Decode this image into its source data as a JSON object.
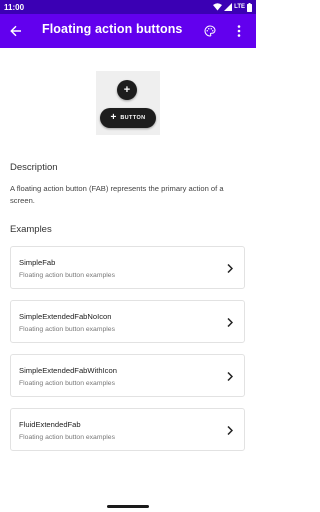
{
  "status_bar": {
    "time": "11:00",
    "network": "LTE",
    "icons": [
      "wifi-icon",
      "signal-icon",
      "battery-icon"
    ]
  },
  "app_bar": {
    "title": "Floating action buttons",
    "back_icon": "arrow-back-icon",
    "palette_icon": "palette-icon",
    "more_icon": "more-vert-icon"
  },
  "preview": {
    "fab_icon": "+",
    "extended_fab_icon": "+",
    "extended_fab_label": "BUTTON"
  },
  "description": {
    "heading": "Description",
    "text": "A floating action button (FAB) represents the primary action of a screen."
  },
  "examples": {
    "heading": "Examples",
    "items": [
      {
        "title": "SimpleFab",
        "subtitle": "Floating action button examples"
      },
      {
        "title": "SimpleExtendedFabNoIcon",
        "subtitle": "Floating action button examples"
      },
      {
        "title": "SimpleExtendedFabWithIcon",
        "subtitle": "Floating action button examples"
      },
      {
        "title": "FluidExtendedFab",
        "subtitle": "Floating action button examples"
      }
    ]
  },
  "colors": {
    "status_bar": "#3b00b4",
    "app_bar": "#6200ee",
    "fab": "#1d1d1d"
  }
}
